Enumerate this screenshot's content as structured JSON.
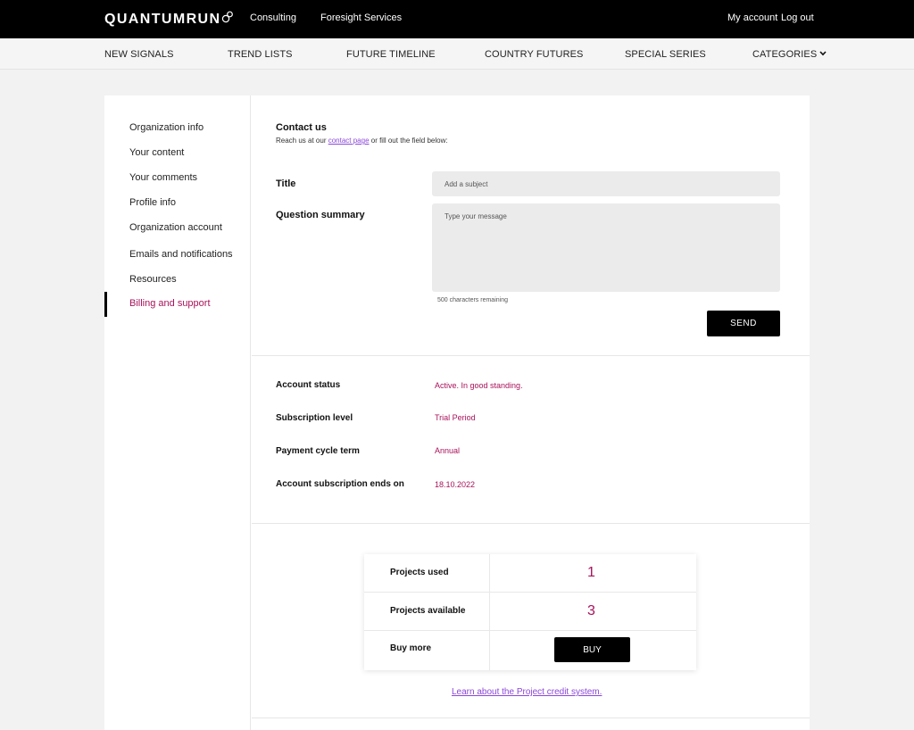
{
  "brand": {
    "logo_text": "QUANTUMRUN"
  },
  "topbar": {
    "links": [
      "Consulting",
      "Foresight Services"
    ],
    "account": "My account",
    "logout": "Log out"
  },
  "nav": {
    "items": [
      "NEW SIGNALS",
      "TREND LISTS",
      "FUTURE TIMELINE",
      "COUNTRY FUTURES",
      "SPECIAL SERIES",
      "CATEGORIES"
    ],
    "dropdown_icon": "chevron-down-icon"
  },
  "sidebar": {
    "items": [
      "Organization info",
      "Your content",
      "Your comments",
      "Profile info",
      "Organization account",
      "Emails and notifications",
      "Resources",
      "Billing and support"
    ],
    "active_index": 7
  },
  "contact": {
    "title": "Contact us",
    "subtitle_prefix": "Reach us at our ",
    "subtitle_link": "contact page",
    "subtitle_suffix": " or fill out the field below:",
    "title_label": "Title",
    "title_placeholder": "Add a subject",
    "summary_label": "Question summary",
    "summary_placeholder": "Type your message",
    "chars_remaining": "500 characters remaining",
    "send_label": "SEND"
  },
  "account": {
    "rows": [
      {
        "label": "Account status",
        "value": "Active. In good standing."
      },
      {
        "label": "Subscription level",
        "value": "Trial Period"
      },
      {
        "label": "Payment cycle term",
        "value": "Annual"
      },
      {
        "label": "Account subscription ends on",
        "value": "18.10.2022"
      }
    ]
  },
  "projects": {
    "used_label": "Projects used",
    "used_value": "1",
    "available_label": "Projects available",
    "available_value": "3",
    "buy_label": "Buy more",
    "buy_button": "BUY",
    "learn_link": "Learn about the Project credit system."
  },
  "colors": {
    "accent": "#a8125a",
    "link": "#8b47d9",
    "topbar": "#000000",
    "background": "#f2f2f2"
  }
}
